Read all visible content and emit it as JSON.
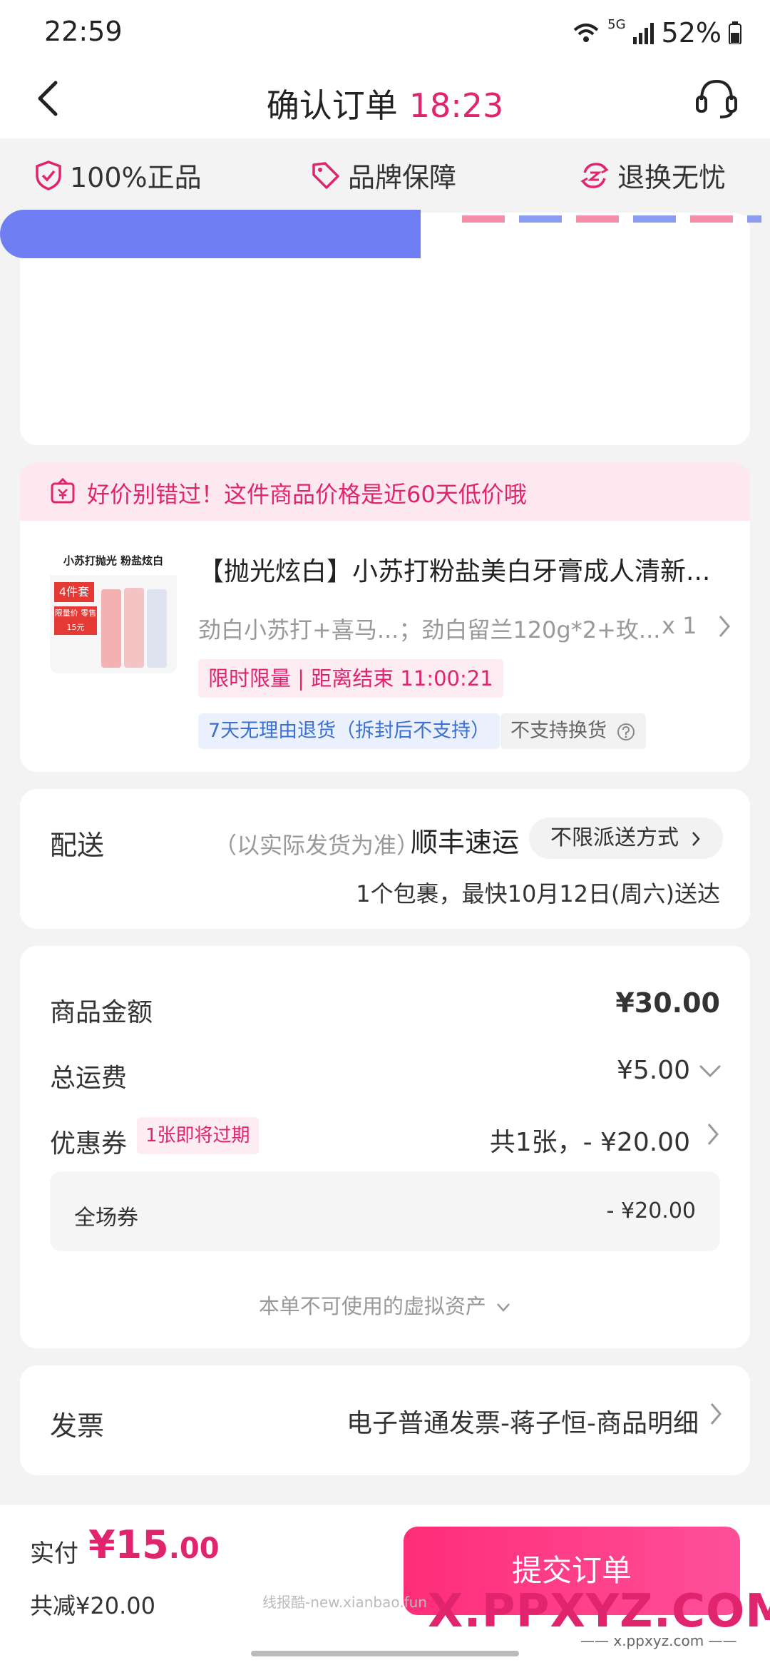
{
  "status_bar": {
    "time": "22:59",
    "network": "5G",
    "battery": "52%"
  },
  "header": {
    "title": "确认订单",
    "timer": "18:23"
  },
  "trust_badges": [
    {
      "icon": "shield-icon",
      "label": "100%正品"
    },
    {
      "icon": "tag-icon",
      "label": "品牌保障"
    },
    {
      "icon": "refresh-icon",
      "label": "退换无忧"
    }
  ],
  "notice": {
    "text": "好价别错过！这件商品价格是近60天低价哦"
  },
  "product": {
    "name": "【抛光炫白】小苏打粉盐美白牙膏成人清新...",
    "spec": "劲白小苏打+喜马...；劲白留兰120g*2+玫...",
    "qty": "x 1",
    "limit_tag": "限时限量 | 距离结束 11:00:21",
    "return_tag": "7天无理由退货（拆封后不支持）",
    "exchange_tag": "不支持换货",
    "thumb_lines": [
      "小苏打抛光 粉盐炫白",
      "4件套",
      "限量价 零售15元"
    ]
  },
  "delivery": {
    "label": "配送",
    "note": "（以实际发货为准）",
    "courier": "顺丰速运",
    "method_button": "不限派送方式",
    "eta": "1个包裹，最快10月12日(周六)送达"
  },
  "pricing": {
    "goods_label": "商品金额",
    "goods_value": "¥30.00",
    "shipping_label": "总运费",
    "shipping_value": "¥5.00",
    "coupon_label": "优惠券",
    "coupon_tag": "1张即将过期",
    "coupon_value": "共1张，- ¥20.00",
    "store_coupon_label": "全场券",
    "store_coupon_value": "- ¥20.00",
    "virtual_assets": "本单不可使用的虚拟资产"
  },
  "invoice": {
    "label": "发票",
    "value": "电子普通发票-蒋子恒-商品明细"
  },
  "footer": {
    "pay_label": "实付",
    "pay_amount_major": "¥15",
    "pay_amount_minor": ".00",
    "saved": "共减¥20.00",
    "submit_label": "提交订单"
  },
  "watermarks": {
    "small": "线报酷-new.xianbao.fun",
    "brand": "X.PPXYZ.COM",
    "url": "—— x.ppxyz.com ——"
  },
  "colors": {
    "accent": "#e0246e",
    "accent_light": "#fdecf2",
    "redaction": "#6f7ef3"
  }
}
